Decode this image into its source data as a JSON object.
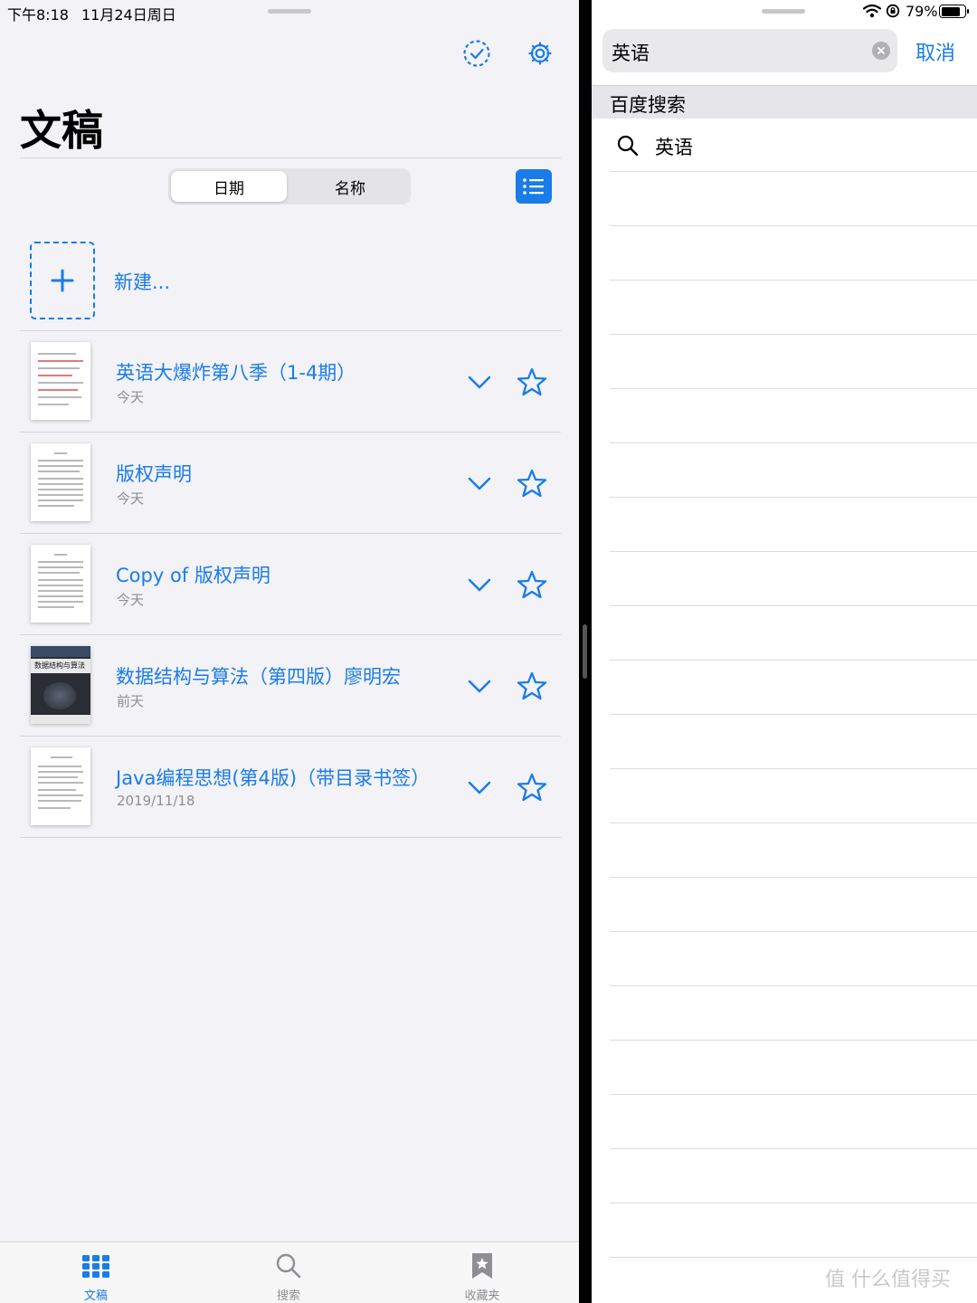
{
  "status": {
    "time": "下午8:18",
    "date": "11月24日周日",
    "battery": "79%"
  },
  "left": {
    "page_title": "文稿",
    "segments": [
      "日期",
      "名称"
    ],
    "new_label": "新建...",
    "documents": [
      {
        "title": "英语大爆炸第八季（1-4期）",
        "date": "今天"
      },
      {
        "title": "版权声明",
        "date": "今天"
      },
      {
        "title": "Copy of 版权声明",
        "date": "今天"
      },
      {
        "title": "数据结构与算法（第四版）廖明宏",
        "date": "前天"
      },
      {
        "title": "Java编程思想(第4版)（带目录书签）",
        "date": "2019/11/18"
      }
    ],
    "cover_text": "数据结构与算法",
    "tabs": [
      {
        "label": "文稿",
        "icon": "grid-icon"
      },
      {
        "label": "搜索",
        "icon": "search-icon"
      },
      {
        "label": "收藏夹",
        "icon": "bookmark-star-icon"
      }
    ]
  },
  "right": {
    "search_value": "英语",
    "cancel_label": "取消",
    "section_title": "百度搜索",
    "suggestion": "英语"
  },
  "watermark": "值 什么值得买",
  "colors": {
    "accent": "#1a7ce8",
    "background": "#f2f2f7",
    "secondary_text": "#8e8e93"
  }
}
